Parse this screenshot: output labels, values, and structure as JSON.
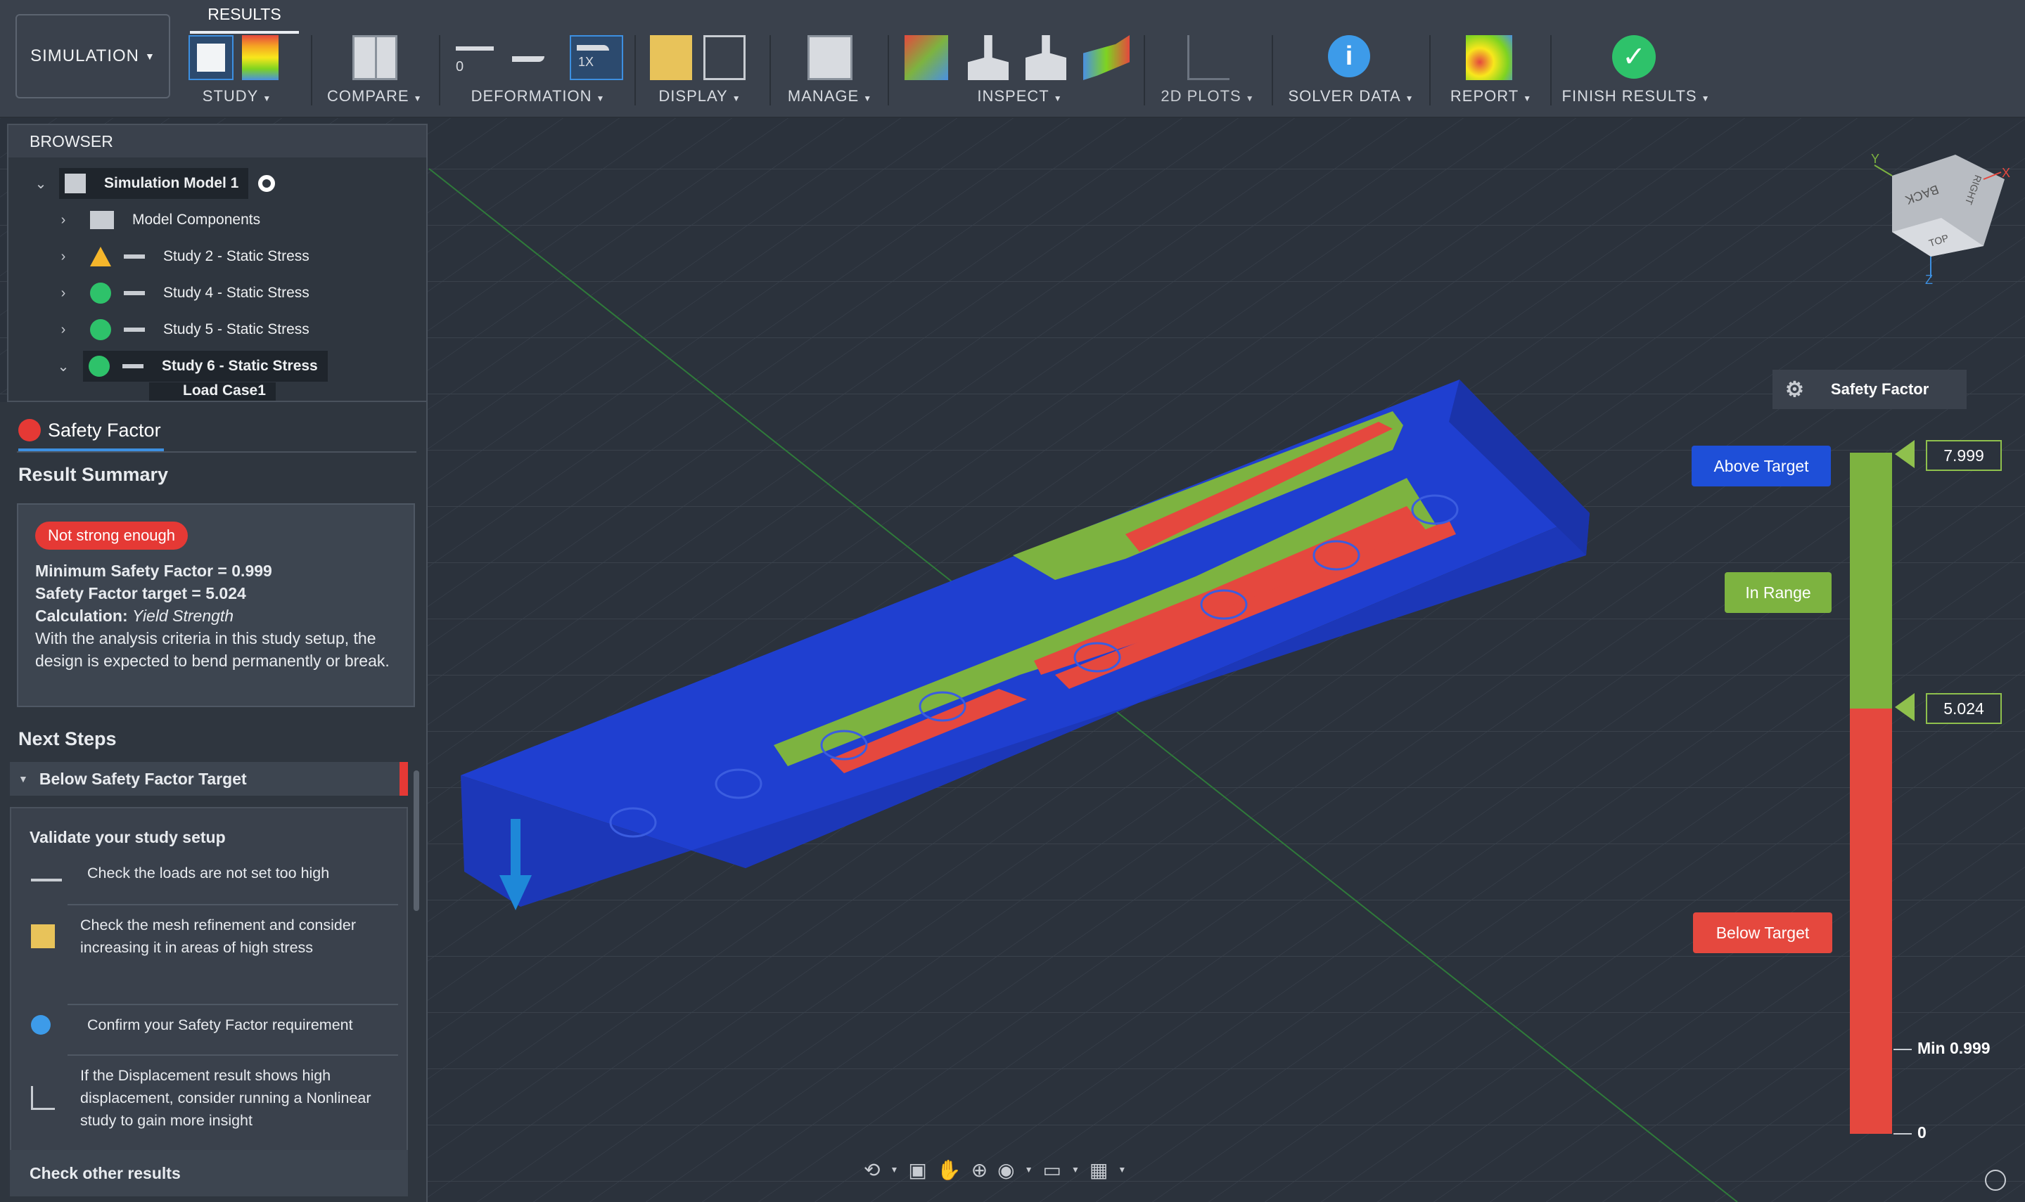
{
  "toolbar": {
    "workspace": "SIMULATION",
    "tab": "RESULTS",
    "groups": {
      "study": "STUDY",
      "compare": "COMPARE",
      "deformation": "DEFORMATION",
      "display": "DISPLAY",
      "manage": "MANAGE",
      "inspect": "INSPECT",
      "plots": "2D PLOTS",
      "solver": "SOLVER DATA",
      "report": "REPORT",
      "finish": "FINISH RESULTS"
    },
    "deform_zero": "0",
    "deform_scale": "1X"
  },
  "browser": {
    "title": "BROWSER",
    "items": [
      {
        "label": "Simulation Model 1"
      },
      {
        "label": "Model Components"
      },
      {
        "label": "Study 2 - Static Stress"
      },
      {
        "label": "Study 4 - Static Stress"
      },
      {
        "label": "Study 5 - Static Stress"
      },
      {
        "label": "Study 6 - Static Stress"
      },
      {
        "label": "Load Case1"
      }
    ]
  },
  "panel": {
    "title": "Safety Factor",
    "summary_title": "Result Summary",
    "badge": "Not strong enough",
    "min_label": "Minimum Safety Factor = 0.999",
    "target_label": "Safety Factor target = 5.024",
    "calc_label": "Calculation:",
    "calc_value": "Yield Strength",
    "description": "With the analysis criteria in this study setup, the design is expected to bend permanently or break.",
    "next_title": "Next Steps",
    "section": "Below Safety Factor Target",
    "validate_title": "Validate your study setup",
    "steps": [
      {
        "text": "Check the loads are not set too high"
      },
      {
        "text": "Check the mesh refinement and consider increasing it in areas of high stress"
      },
      {
        "text": "Confirm your Safety Factor requirement"
      },
      {
        "text": "If the Displacement result shows high displacement, consider running a Nonlinear study to gain more insight"
      }
    ],
    "other": "Check other results"
  },
  "legend": {
    "title": "Safety Factor",
    "above": "Above Target",
    "in_range": "In Range",
    "below": "Below Target",
    "max_value": "7.999",
    "target_value": "5.024",
    "min_label": "Min 0.999",
    "zero": "0"
  },
  "viewcube": {
    "top": "TOP",
    "back": "BACK",
    "right": "RIGHT",
    "axis_y": "Y",
    "axis_z": "Z",
    "axis_x": "X"
  },
  "colors": {
    "above": "#1e4fd8",
    "in_range": "#7db340",
    "below": "#e5483e",
    "accent": "#3d8fe0"
  }
}
